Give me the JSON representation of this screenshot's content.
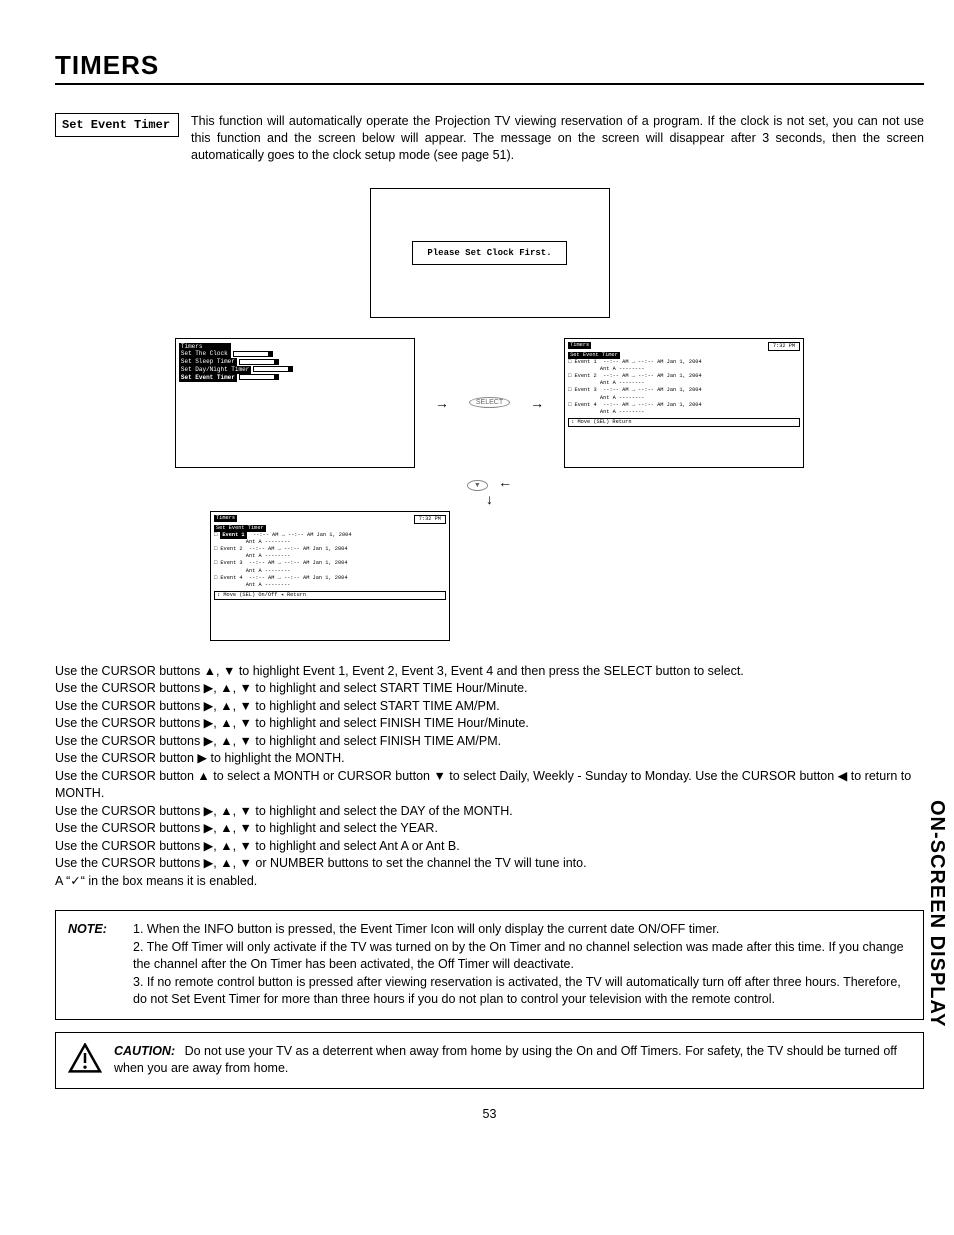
{
  "title": "TIMERS",
  "section_label": "Set Event Timer",
  "intro": "This function will automatically operate the Projection TV viewing reservation of a program.  If the clock is not set, you can not use this function and the screen below will appear.  The message on the screen will disappear after 3 seconds, then the screen automatically goes to the clock setup mode (see page 51).",
  "clock_msg": "Please Set Clock First.",
  "menu": {
    "header": "Timers",
    "items": [
      "Set The Clock",
      "Set Sleep Timer",
      "Set Day/Night Timer",
      "Set Event Timer"
    ]
  },
  "select_btn": "SELECT",
  "event_panel": {
    "breadcrumb1": "Timers",
    "breadcrumb2": "Set Event Timer",
    "time": "7:32 PM",
    "rows": [
      {
        "label": "Event 1",
        "line": "--:-- AM → --:-- AM  Jan 1, 2004",
        "ant": "Ant A --------"
      },
      {
        "label": "Event 2",
        "line": "--:-- AM → --:-- AM  Jan 1, 2004",
        "ant": "Ant A --------"
      },
      {
        "label": "Event 3",
        "line": "--:-- AM → --:-- AM  Jan 1, 2004",
        "ant": "Ant A --------"
      },
      {
        "label": "Event 4",
        "line": "--:-- AM → --:-- AM  Jan 1, 2004",
        "ant": "Ant A --------"
      }
    ],
    "return1": "↕ Move  (SEL) Return",
    "return2": "↕ Move  (SEL) On/Off  ◂ Return"
  },
  "instructions": [
    "Use the CURSOR buttons ▲, ▼ to highlight Event 1, Event 2, Event 3, Event 4 and then press the SELECT button to select.",
    "Use the CURSOR buttons ▶, ▲, ▼ to highlight and select START TIME Hour/Minute.",
    "Use the CURSOR buttons ▶, ▲, ▼ to highlight and select START TIME AM/PM.",
    "Use the CURSOR buttons ▶, ▲, ▼ to highlight and select FINISH TIME Hour/Minute.",
    "Use the CURSOR buttons ▶, ▲, ▼ to highlight and select FINISH TIME AM/PM.",
    "Use the CURSOR button ▶ to highlight the MONTH.",
    "Use the CURSOR button ▲ to select a MONTH or CURSOR button ▼ to select Daily, Weekly - Sunday to Monday.  Use the CURSOR button ◀ to return to MONTH.",
    "Use the CURSOR buttons ▶, ▲, ▼ to highlight and select the DAY of the MONTH.",
    "Use the CURSOR buttons ▶, ▲, ▼ to highlight and select the YEAR.",
    "Use the CURSOR buttons ▶, ▲, ▼ to highlight and select Ant A or Ant B.",
    "Use the CURSOR buttons ▶, ▲, ▼ or NUMBER buttons to set the channel the TV will tune into.",
    "A “✓“ in the box means it is enabled."
  ],
  "note": {
    "label": "NOTE:",
    "items": [
      "1. When the INFO button is pressed, the Event Timer Icon will only display the current date ON/OFF timer.",
      "2. The Off Timer will only activate if the TV was turned on by the On Timer and no channel selection was made after this time.  If you change the channel after the On Timer has been activated, the Off Timer will deactivate.",
      "3. If no remote control button is pressed after viewing reservation is activated, the TV will automatically turn off after three hours.  Therefore, do not Set Event Timer for more than three hours if you do not plan to control your television with the remote control."
    ]
  },
  "caution": {
    "label": "CAUTION:",
    "text": "Do not use your TV as a deterrent when away from home by using the On and Off Timers.  For safety, the TV should be turned off when you are away from home."
  },
  "side_label": "ON-SCREEN DISPLAY",
  "page": "53"
}
